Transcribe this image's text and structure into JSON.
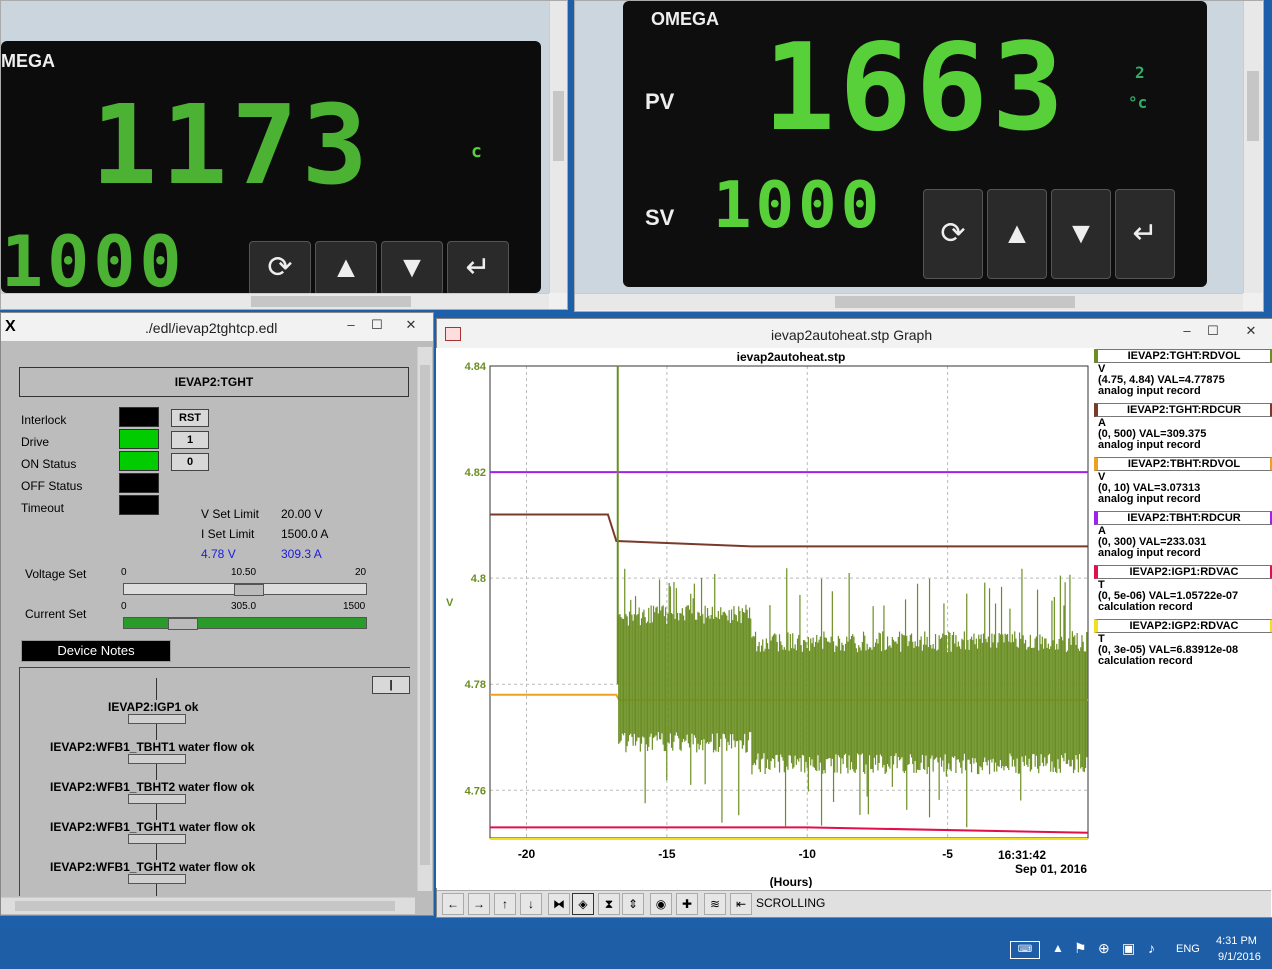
{
  "camera_left": {
    "brand": "MEGA",
    "pv_display": "1173",
    "sv_display": "1000",
    "unit": "c",
    "keys": [
      "⟳",
      "▲",
      "▼",
      "↵"
    ]
  },
  "camera_right": {
    "brand": "OMEGA",
    "pv_label": "PV",
    "sv_label": "SV",
    "pv_display": "1663",
    "sv_display": "1000",
    "unit_top": "2",
    "unit": "°c",
    "keys": [
      "⟳",
      "▲",
      "▼",
      "↵"
    ]
  },
  "edl": {
    "window_title": "./edl/ievap2tghtcp.edl",
    "icon": "X",
    "header": "IEVAP2:TGHT",
    "rows": [
      {
        "label": "Interlock",
        "color": "#000000",
        "button": "RST"
      },
      {
        "label": "Drive",
        "color": "#00cc00",
        "button": "1"
      },
      {
        "label": "ON Status",
        "color": "#00cc00",
        "button": "0"
      },
      {
        "label": "OFF Status",
        "color": "#000000",
        "button": ""
      },
      {
        "label": "Timeout",
        "color": "#000000",
        "button": ""
      }
    ],
    "v_set_limit_label": "V Set Limit",
    "v_set_limit_value": "20.00 V",
    "i_set_limit_label": "I Set Limit",
    "i_set_limit_value": "1500.0 A",
    "voltage_readback": "4.78 V",
    "current_readback": "309.3 A",
    "voltage_set": {
      "label": "Voltage Set",
      "min": "0",
      "mid": "10.50",
      "max": "20"
    },
    "current_set": {
      "label": "Current Set",
      "min": "0",
      "mid": "305.0",
      "max": "1500"
    },
    "device_notes_label": "Device Notes",
    "toggle_label": "|",
    "interlocks": [
      "IEVAP2:IGP1 ok",
      "IEVAP2:WFB1_TBHT1 water flow ok",
      "IEVAP2:WFB1_TBHT2 water flow ok",
      "IEVAP2:WFB1_TGHT1 water flow ok",
      "IEVAP2:WFB1_TGHT2 water flow ok"
    ]
  },
  "graph": {
    "window_title": "ievap2autoheat.stp Graph",
    "plot_title": "ievap2autoheat.stp",
    "ylabel": "V",
    "xlabel": "(Hours)",
    "time_label": "16:31:42",
    "date_label": "Sep 01, 2016",
    "y_ticks": [
      "4.84",
      "4.82",
      "4.8",
      "4.78",
      "4.76"
    ],
    "x_ticks": [
      "-20",
      "-15",
      "-10",
      "-5"
    ],
    "mode_label": "SCROLLING",
    "toolbar_icons": [
      "arrow-left-icon",
      "arrow-right-icon",
      "arrow-up-icon",
      "arrow-down-icon",
      "zoom-in-x-icon",
      "zoom-out-x-icon",
      "zoom-in-y-icon",
      "zoom-out-y-icon",
      "record-icon",
      "crosshair-icon",
      "autoscale-icon",
      "goto-end-icon"
    ],
    "legend": [
      {
        "name": "IEVAP2:TGHT:RDVOL",
        "color": "#6b8e23",
        "unit": "V",
        "range": "(4.75, 4.84) VAL=4.77875",
        "type": "analog input record"
      },
      {
        "name": "IEVAP2:TGHT:RDCUR",
        "color": "#7a3a2a",
        "unit": "A",
        "range": "(0, 500) VAL=309.375",
        "type": "analog input record"
      },
      {
        "name": "IEVAP2:TBHT:RDVOL",
        "color": "#f0a020",
        "unit": "V",
        "range": "(0, 10) VAL=3.07313",
        "type": "analog input record"
      },
      {
        "name": "IEVAP2:TBHT:RDCUR",
        "color": "#a020f0",
        "unit": "A",
        "range": "(0, 300) VAL=233.031",
        "type": "analog input record"
      },
      {
        "name": "IEVAP2:IGP1:RDVAC",
        "color": "#e0104a",
        "unit": "T",
        "range": "(0, 5e-06) VAL=1.05722e-07",
        "type": "calculation record"
      },
      {
        "name": "IEVAP2:IGP2:RDVAC",
        "color": "#f0e020",
        "unit": "T",
        "range": "(0, 3e-05) VAL=6.83912e-08",
        "type": "calculation record"
      }
    ]
  },
  "chart_data": {
    "type": "line",
    "title": "ievap2autoheat.stp",
    "xlabel": "(Hours)",
    "ylabel": "V",
    "xlim": [
      -21.3,
      0
    ],
    "ylim": [
      4.751,
      4.84
    ],
    "grid": true,
    "series": [
      {
        "name": "IEVAP2:TGHT:RDVOL",
        "color": "#6b8e23",
        "x": [
          -21.3,
          -16.8,
          -16.75,
          -16.7,
          -16.5,
          -12,
          -11.8,
          0
        ],
        "y": [
          4.751,
          4.751,
          4.84,
          4.79,
          4.785,
          4.78,
          4.775,
          4.775
        ]
      },
      {
        "name": "IEVAP2:TGHT:RDCUR",
        "color": "#7a3a2a",
        "x": [
          -21.3,
          -17.1,
          -16.8,
          -12,
          0
        ],
        "y": [
          4.812,
          4.812,
          4.807,
          4.806,
          4.806
        ]
      },
      {
        "name": "IEVAP2:TBHT:RDVOL",
        "color": "#f0a020",
        "x": [
          -21.3,
          -16.8,
          -16.7,
          -12,
          0
        ],
        "y": [
          4.778,
          4.778,
          4.777,
          4.777,
          4.777
        ]
      },
      {
        "name": "IEVAP2:TBHT:RDCUR",
        "color": "#a020f0",
        "x": [
          -21.3,
          0
        ],
        "y": [
          4.82,
          4.82
        ]
      },
      {
        "name": "IEVAP2:IGP1:RDVAC",
        "color": "#e0104a",
        "x": [
          -21.3,
          -10,
          0
        ],
        "y": [
          4.753,
          4.753,
          4.752
        ]
      },
      {
        "name": "IEVAP2:IGP2:RDVAC",
        "color": "#f0e020",
        "x": [
          -21.3,
          0
        ],
        "y": [
          4.7508,
          4.7508
        ]
      }
    ]
  },
  "taskbar": {
    "lang": "ENG",
    "time": "4:31 PM",
    "date": "9/1/2016"
  }
}
